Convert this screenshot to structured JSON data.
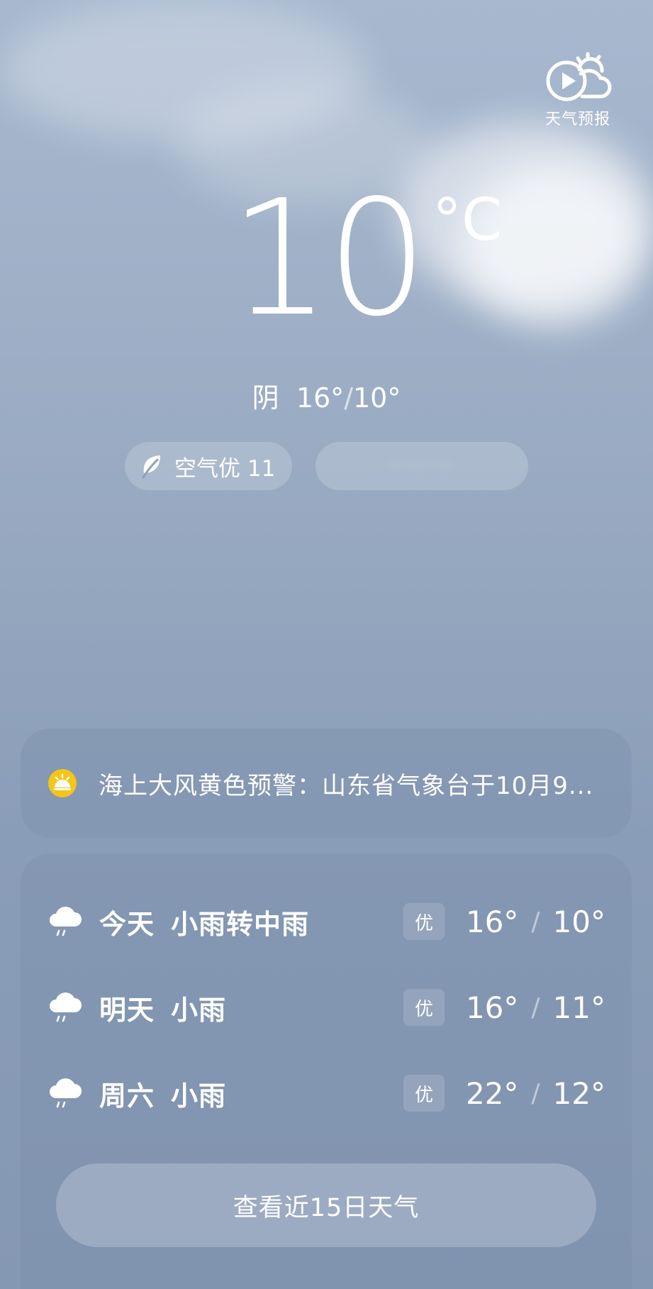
{
  "header": {
    "forecast_label": "天气预报"
  },
  "current": {
    "temperature": "10",
    "unit": "°C",
    "condition": "阴",
    "high": "16°",
    "low": "10°",
    "separator": "/"
  },
  "chips": {
    "air_quality": "空气优 11",
    "blurred": "········"
  },
  "alert": {
    "text": "海上大风黄色预警：山东省气象台于10月9..."
  },
  "daily": [
    {
      "day": "今天",
      "condition": "小雨转中雨",
      "aqi": "优",
      "high": "16°",
      "low": "10°",
      "icon": "rain-cloud-icon"
    },
    {
      "day": "明天",
      "condition": "小雨",
      "aqi": "优",
      "high": "16°",
      "low": "11°",
      "icon": "rain-cloud-icon"
    },
    {
      "day": "周六",
      "condition": "小雨",
      "aqi": "优",
      "high": "22°",
      "low": "12°",
      "icon": "rain-cloud-icon"
    }
  ],
  "buttons": {
    "view_15_days": "查看近15日天气"
  },
  "colors": {
    "background_top": "#a7b8cf",
    "background_bottom": "#8598b3",
    "alert_icon": "#f5c518"
  }
}
